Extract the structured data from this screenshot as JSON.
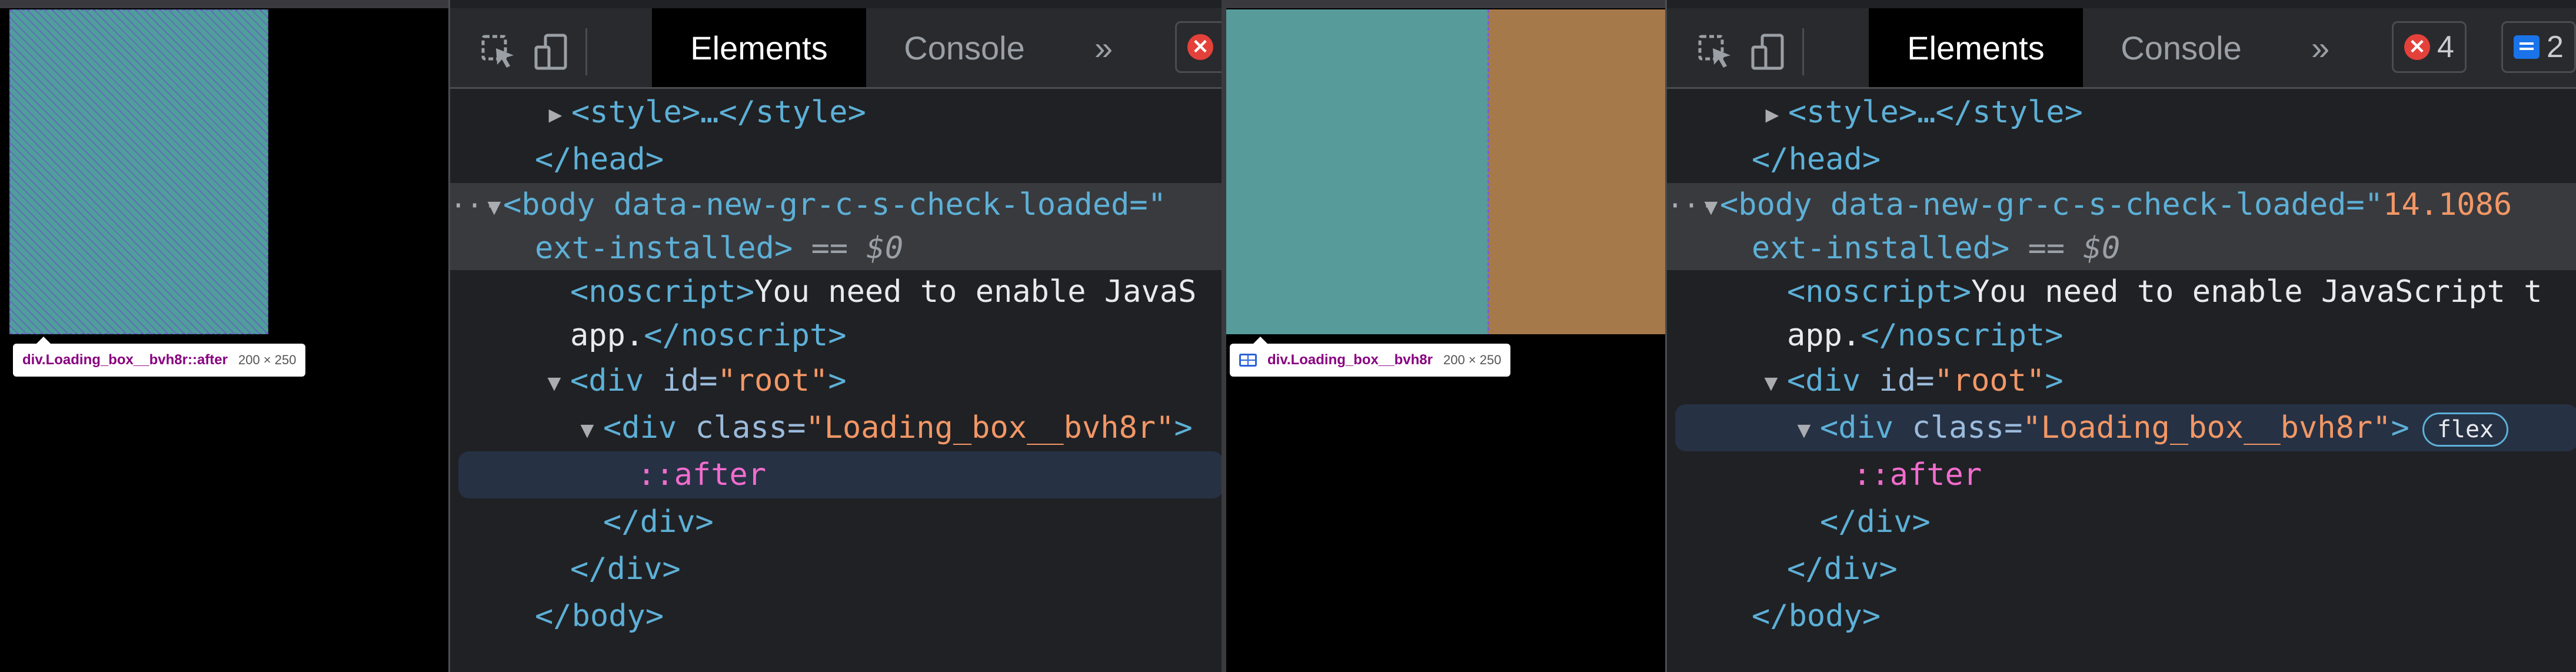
{
  "left": {
    "tooltip": {
      "tag": "div",
      "selector": ".Loading_box__bvh8r::after",
      "size": "200 × 250"
    },
    "toolbar": {
      "tabs": [
        "Elements",
        "Console"
      ],
      "more": "»"
    },
    "code": {
      "style_line": "<style>…</style>",
      "head_close": "</head>",
      "body_open": "<body data-new-gr-c-s-check-loaded=\"",
      "body_cont": "ext-installed>",
      "eq": " == ",
      "dollar0": "$0",
      "noscript_a": "<noscript>",
      "noscript_text": "You need to enable JavaS",
      "noscript_b": "app.",
      "noscript_close": "</noscript>",
      "div_root_open": "<div ",
      "div_root_attr": "id=",
      "div_root_val": "\"root\"",
      "div_root_end": ">",
      "div_box_open": "<div ",
      "div_box_attr": "class=",
      "div_box_val": "\"Loading_box__bvh8r\"",
      "div_box_end": ">",
      "after": "::after",
      "div_close1": "</div>",
      "div_close2": "</div>",
      "body_close": "</body>"
    }
  },
  "right": {
    "tooltip": {
      "tag": "div",
      "selector": ".Loading_box__bvh8r",
      "size": "200 × 250"
    },
    "toolbar": {
      "tabs": [
        "Elements",
        "Console"
      ],
      "more": "»",
      "errors": "4",
      "messages": "2"
    },
    "code": {
      "style_line": "<style>…</style>",
      "head_close": "</head>",
      "body_open": "<body data-new-gr-c-s-check-loaded=\"",
      "body_val": "14.1086",
      "body_cont": "ext-installed>",
      "eq": " == ",
      "dollar0": "$0",
      "noscript_a": "<noscript>",
      "noscript_text": "You need to enable JavaScript t",
      "noscript_b": "app.",
      "noscript_close": "</noscript>",
      "div_root_open": "<div ",
      "div_root_attr": "id=",
      "div_root_val": "\"root\"",
      "div_root_end": ">",
      "div_box_open": "<div ",
      "div_box_attr": "class=",
      "div_box_val": "\"Loading_box__bvh8r\"",
      "div_box_end": ">",
      "flex_badge": "flex",
      "after": "::after",
      "div_close1": "</div>",
      "div_close2": "</div>",
      "body_close": "</body>"
    }
  },
  "colors": {
    "devtools_bg": "#202124",
    "toolbar_bg": "#292a2d",
    "tag": "#5db0d7",
    "attr_value": "#f29766",
    "pseudo": "#f26cce",
    "teal_box": "#579b9b",
    "brown_box": "#a6794b"
  }
}
